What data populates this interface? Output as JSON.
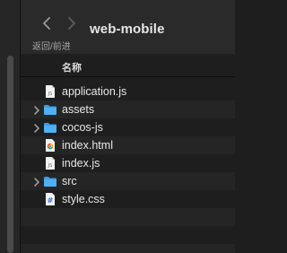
{
  "toolbar": {
    "title": "web-mobile",
    "back_forward_label": "返回/前进"
  },
  "list": {
    "header_name": "名称",
    "items": [
      {
        "name": "application.js",
        "kind": "js-file-icon",
        "expandable": false
      },
      {
        "name": "assets",
        "kind": "folder-icon",
        "expandable": true
      },
      {
        "name": "cocos-js",
        "kind": "folder-icon",
        "expandable": true
      },
      {
        "name": "index.html",
        "kind": "html-file-icon",
        "expandable": false
      },
      {
        "name": "index.js",
        "kind": "js-file-icon",
        "expandable": false
      },
      {
        "name": "src",
        "kind": "folder-icon",
        "expandable": true
      },
      {
        "name": "style.css",
        "kind": "css-file-icon",
        "expandable": false
      }
    ]
  },
  "colors": {
    "background": "#1e1e1e",
    "folder": "#3a9ee6",
    "text": "#e8e8e8"
  }
}
